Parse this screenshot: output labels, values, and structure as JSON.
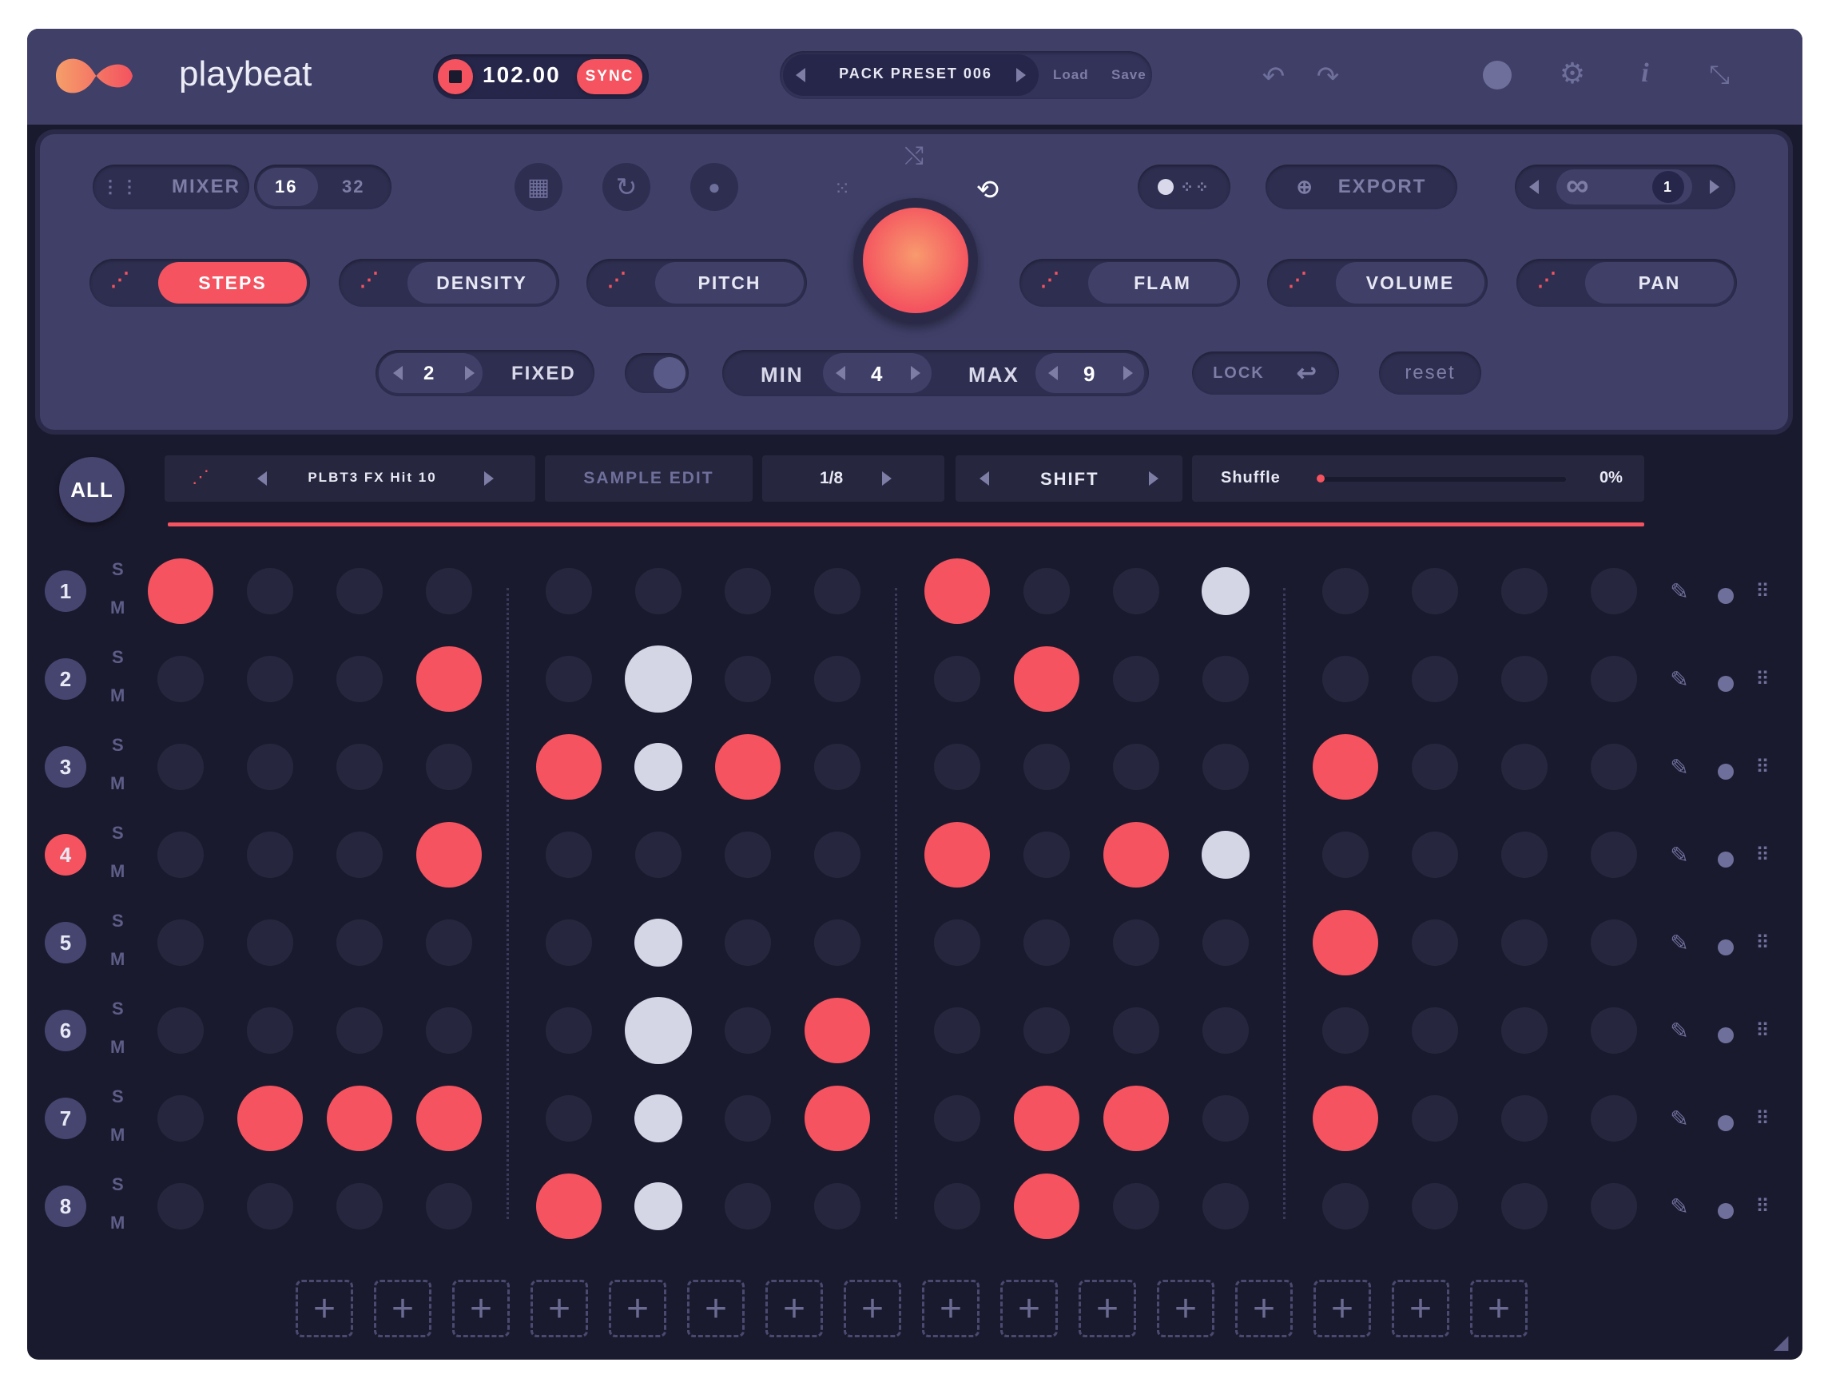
{
  "app": {
    "name": "playbeat"
  },
  "transport": {
    "bpm": "102.00",
    "sync_label": "SYNC"
  },
  "preset": {
    "name": "PACK PRESET 006",
    "load_label": "Load",
    "save_label": "Save"
  },
  "controls": {
    "mixer_label": "MIXER",
    "steps16": "16",
    "steps32": "32",
    "export_label": "EXPORT",
    "loop_value": "1",
    "modes": [
      {
        "label": "STEPS",
        "active": true
      },
      {
        "label": "DENSITY",
        "active": false
      },
      {
        "label": "PITCH",
        "active": false
      },
      {
        "label": "FLAM",
        "active": false
      },
      {
        "label": "VOLUME",
        "active": false
      },
      {
        "label": "PAN",
        "active": false
      }
    ],
    "fixed_value": "2",
    "fixed_label": "FIXED",
    "min_label": "MIN",
    "min_value": "4",
    "max_label": "MAX",
    "max_value": "9",
    "lock_label": "LOCK",
    "reset_label": "reset"
  },
  "track_bar": {
    "all_label": "ALL",
    "sample_name": "PLBT3 FX Hit 10",
    "sample_edit_label": "SAMPLE EDIT",
    "rate": "1/8",
    "shift_label": "SHIFT",
    "shuffle_label": "Shuffle",
    "shuffle_value": "0%"
  },
  "rows": [
    {
      "num": "1",
      "s": "S",
      "m": "M",
      "active": false,
      "steps": [
        2,
        0,
        0,
        0,
        0,
        0,
        0,
        0,
        2,
        0,
        0,
        1,
        0,
        0,
        0,
        0
      ]
    },
    {
      "num": "2",
      "s": "S",
      "m": "M",
      "active": false,
      "steps": [
        0,
        0,
        0,
        2,
        0,
        3,
        0,
        0,
        0,
        2,
        0,
        0,
        0,
        0,
        0,
        0
      ]
    },
    {
      "num": "3",
      "s": "S",
      "m": "M",
      "active": false,
      "steps": [
        0,
        0,
        0,
        0,
        2,
        1,
        2,
        0,
        0,
        0,
        0,
        0,
        2,
        0,
        0,
        0
      ]
    },
    {
      "num": "4",
      "s": "S",
      "m": "M",
      "active": true,
      "steps": [
        0,
        0,
        0,
        2,
        0,
        0,
        0,
        0,
        2,
        0,
        2,
        1,
        0,
        0,
        0,
        0
      ]
    },
    {
      "num": "5",
      "s": "S",
      "m": "M",
      "active": false,
      "steps": [
        0,
        0,
        0,
        0,
        0,
        1,
        0,
        0,
        0,
        0,
        0,
        0,
        2,
        0,
        0,
        0
      ]
    },
    {
      "num": "6",
      "s": "S",
      "m": "M",
      "active": false,
      "steps": [
        0,
        0,
        0,
        0,
        0,
        3,
        0,
        2,
        0,
        0,
        0,
        0,
        0,
        0,
        0,
        0
      ]
    },
    {
      "num": "7",
      "s": "S",
      "m": "M",
      "active": false,
      "steps": [
        0,
        2,
        2,
        2,
        0,
        1,
        0,
        2,
        0,
        2,
        2,
        0,
        2,
        0,
        0,
        0
      ]
    },
    {
      "num": "8",
      "s": "S",
      "m": "M",
      "active": false,
      "steps": [
        0,
        0,
        0,
        0,
        2,
        1,
        0,
        0,
        0,
        2,
        0,
        0,
        0,
        0,
        0,
        0
      ]
    }
  ],
  "add_slots": [
    "+",
    "+",
    "+",
    "+",
    "+",
    "+",
    "+",
    "+",
    "+",
    "+",
    "+",
    "+",
    "+",
    "+",
    "+",
    "+"
  ],
  "colors": {
    "accent": "#f4535f",
    "white_step": "#d4d6e6",
    "empty_step": "#26263f",
    "panel": "#3f3f68",
    "background": "#1a1a2e"
  }
}
